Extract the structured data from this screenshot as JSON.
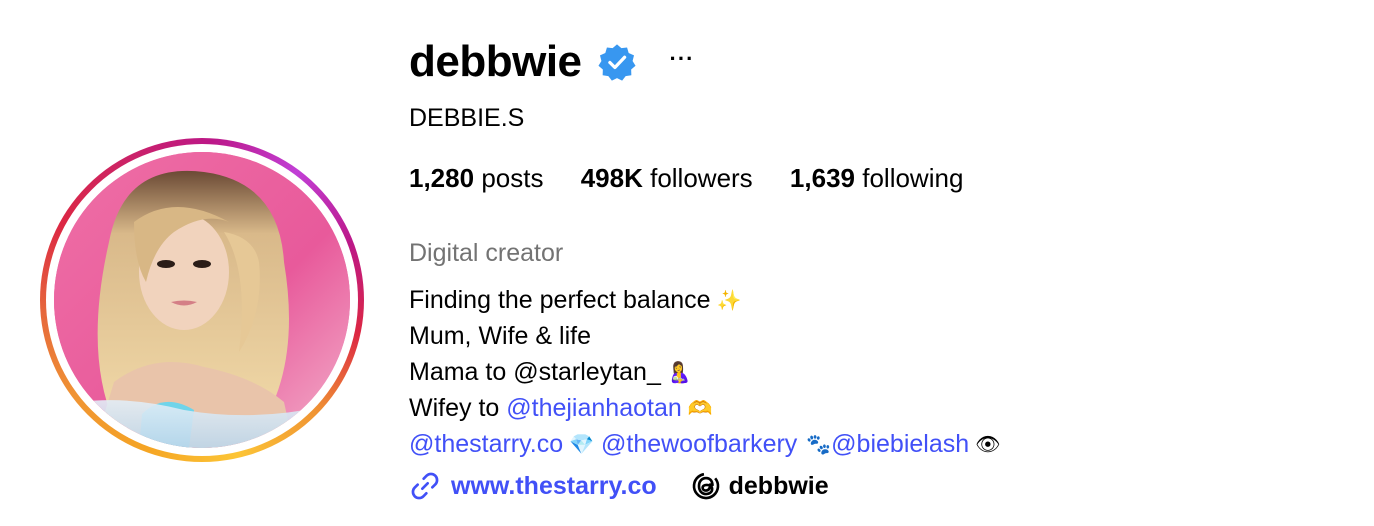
{
  "profile": {
    "username": "debbwie",
    "verified_icon": "verified-badge-icon",
    "more_label": "···",
    "full_name": "DEBBIE.S",
    "stats": {
      "posts_count": "1,280",
      "posts_label": "posts",
      "followers_count": "498K",
      "followers_label": "followers",
      "following_count": "1,639",
      "following_label": "following"
    },
    "category": "Digital creator",
    "bio": {
      "line1": "Finding the perfect balance",
      "line1_emoji": "✨",
      "line2": "Mum, Wife & life",
      "line3": "Mama to @starleytan_",
      "line3_emoji": "🤱",
      "line4_prefix": "Wifey to ",
      "line4_mention": "@thejianhaotan",
      "line4_emoji": "🫶",
      "line5_mention1": "@thestarry.co",
      "line5_emoji1": "💎",
      "line5_mention2": "@thewoofbarkery",
      "line5_emoji2": "🐾",
      "line5_mention3": "@biebielash",
      "line5_emoji3": "👁"
    },
    "website": "www.thestarry.co",
    "threads_handle": "debbwie"
  },
  "colors": {
    "link": "#4150f7",
    "verified": "#3897f0",
    "category": "#737373"
  }
}
